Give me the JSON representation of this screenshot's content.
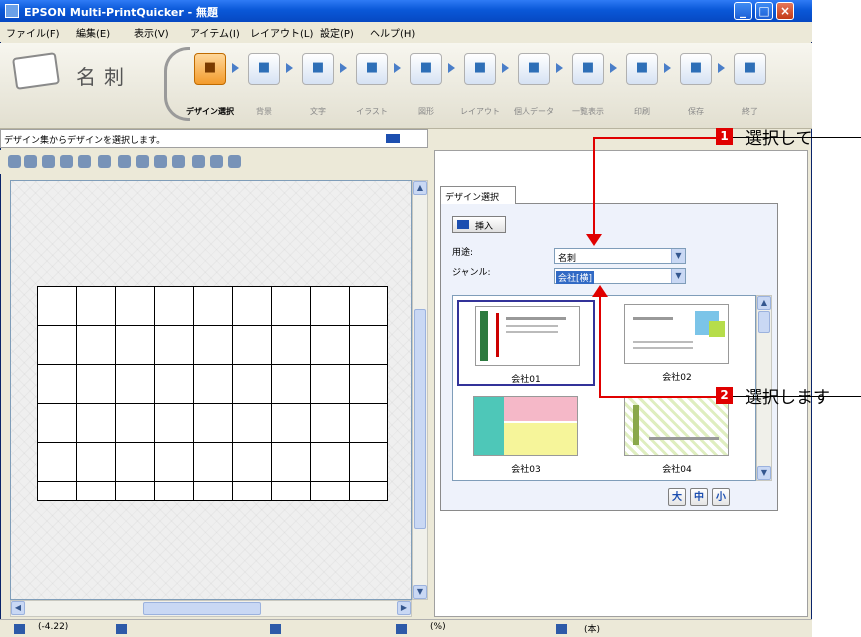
{
  "window": {
    "title": "EPSON Multi-PrintQuicker - 無題"
  },
  "menu": [
    "ファイル(F)",
    "編集(E)",
    "表示(V)",
    "アイテム(I)",
    "レイアウト(L)",
    "設定(P)",
    "ヘルプ(H)"
  ],
  "mode": {
    "label": "名刺",
    "tools": [
      {
        "label": "デザイン選択",
        "icon": "design-select-icon",
        "active": true
      },
      {
        "label": "背景",
        "icon": "background-icon",
        "active": false
      },
      {
        "label": "文字",
        "icon": "text-icon",
        "active": false
      },
      {
        "label": "イラスト",
        "icon": "illustration-icon",
        "active": false
      },
      {
        "label": "図形",
        "icon": "shape-icon",
        "active": false
      },
      {
        "label": "レイアウト",
        "icon": "layout-icon",
        "active": false
      },
      {
        "label": "個人データ",
        "icon": "personal-data-icon",
        "active": false
      },
      {
        "label": "一覧表示",
        "icon": "list-view-icon",
        "active": false
      },
      {
        "label": "印刷",
        "icon": "print-icon",
        "active": false
      },
      {
        "label": "保存",
        "icon": "save-icon",
        "active": false
      },
      {
        "label": "終了",
        "icon": "exit-icon",
        "active": false
      }
    ]
  },
  "hint": {
    "text": "デザイン集からデザインを選択します。"
  },
  "panel": {
    "tab": "デザイン選択",
    "insert_label": "挿入",
    "purpose_label": "用途:",
    "purpose_value": "名刺",
    "genre_label": "ジャンル:",
    "genre_value": "会社[横]",
    "designs": [
      {
        "caption": "会社01",
        "selected": true
      },
      {
        "caption": "会社02",
        "selected": false
      },
      {
        "caption": "会社03",
        "selected": false
      },
      {
        "caption": "会社04",
        "selected": false
      }
    ],
    "size_buttons": [
      "大",
      "中",
      "小"
    ]
  },
  "statusbar": {
    "coords": "(-4.22)",
    "zoom": "(%)",
    "unit": "(本)"
  },
  "callouts": [
    {
      "number": "1",
      "text": "選択して"
    },
    {
      "number": "2",
      "text": "選択します"
    }
  ],
  "colors": {
    "titlebar": "#0a58d8",
    "callout": "#e00000",
    "selection": "#316ac5"
  }
}
